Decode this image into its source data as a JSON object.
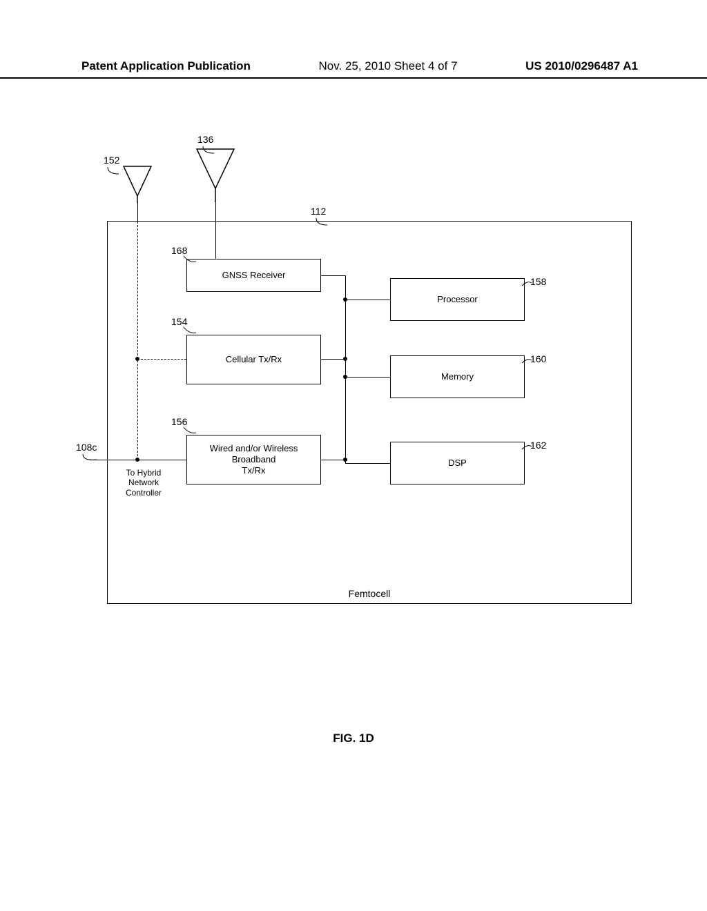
{
  "header": {
    "left": "Patent Application Publication",
    "mid": "Nov. 25, 2010  Sheet 4 of 7",
    "right": "US 2010/0296487 A1"
  },
  "refs": {
    "r152": "152",
    "r136": "136",
    "r112": "112",
    "r168": "168",
    "r154": "154",
    "r156": "156",
    "r158": "158",
    "r160": "160",
    "r162": "162",
    "r108c": "108c"
  },
  "blocks": {
    "gnss": "GNSS Receiver",
    "cellular": "Cellular Tx/Rx",
    "broadband_l1": "Wired and/or Wireless",
    "broadband_l2": "Broadband",
    "broadband_l3": "Tx/Rx",
    "processor": "Processor",
    "memory": "Memory",
    "dsp": "DSP",
    "femtocell": "Femtocell"
  },
  "ext": {
    "to_hybrid_l1": "To Hybrid",
    "to_hybrid_l2": "Network",
    "to_hybrid_l3": "Controller"
  },
  "caption": "FIG. 1D"
}
